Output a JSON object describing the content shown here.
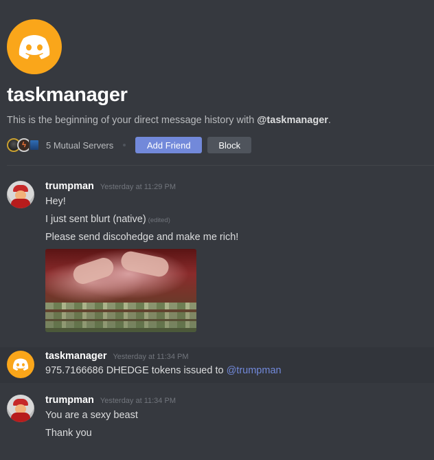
{
  "profile": {
    "username": "taskmanager",
    "intro_prefix": "This is the beginning of your direct message history with ",
    "intro_handle": "@taskmanager",
    "intro_suffix": ".",
    "mutual_servers": "5 Mutual Servers",
    "add_friend": "Add Friend",
    "block": "Block",
    "avatar_color": "#faa61a",
    "accent": "#7289da"
  },
  "messages": [
    {
      "author": "trumpman",
      "time": "Yesterday at 11:29 PM",
      "lines": [
        "Hey!",
        "I just sent blurt (native)",
        "Please send discohedge and make me rich!"
      ],
      "edited": "(edited)"
    },
    {
      "author": "taskmanager",
      "time": "Yesterday at 11:34 PM",
      "text_prefix": "975.7166686 DHEDGE tokens issued to ",
      "mention": "@trumpman"
    },
    {
      "author": "trumpman",
      "time": "Yesterday at 11:34 PM",
      "lines": [
        "You are a sexy beast",
        "Thank you"
      ]
    }
  ]
}
